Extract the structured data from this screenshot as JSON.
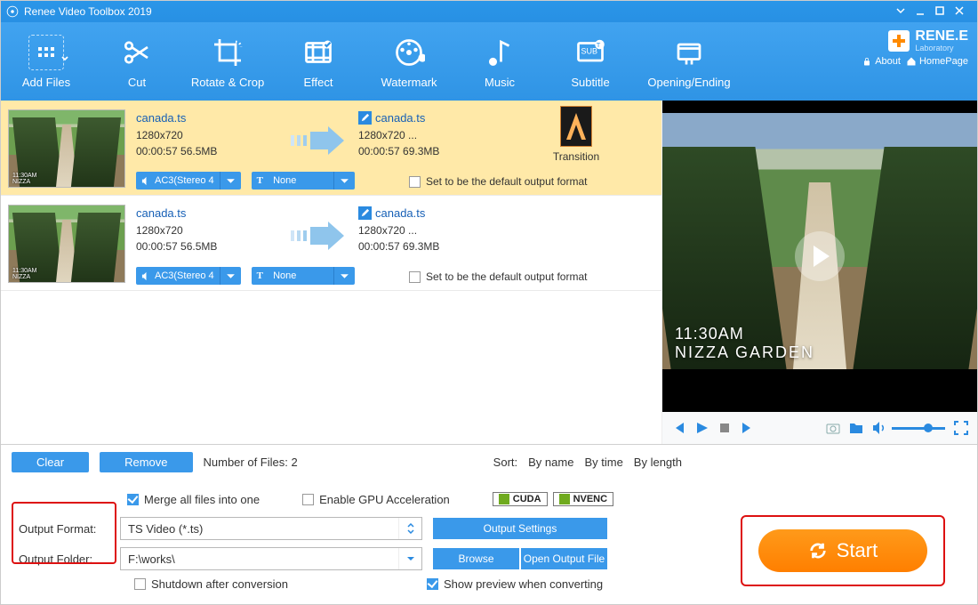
{
  "title": "Renee Video Toolbox 2019",
  "brand": {
    "name": "RENE.E",
    "sub": "Laboratory",
    "about": "About",
    "homepage": "HomePage"
  },
  "toolbar": {
    "addfiles": "Add Files",
    "cut": "Cut",
    "rotate": "Rotate & Crop",
    "effect": "Effect",
    "watermark": "Watermark",
    "music": "Music",
    "subtitle": "Subtitle",
    "opening": "Opening/Ending"
  },
  "rows": [
    {
      "in": {
        "name": "canada.ts",
        "res": "1280x720",
        "dur": "00:00:57  56.5MB"
      },
      "out": {
        "name": "canada.ts",
        "res": "1280x720    ...",
        "dur": "00:00:57  69.3MB"
      },
      "audio": "AC3(Stereo 4",
      "text": "None",
      "deflabel": "Set to be the default output format",
      "trn": "Transition"
    },
    {
      "in": {
        "name": "canada.ts",
        "res": "1280x720",
        "dur": "00:00:57  56.5MB"
      },
      "out": {
        "name": "canada.ts",
        "res": "1280x720    ...",
        "dur": "00:00:57  69.3MB"
      },
      "audio": "AC3(Stereo 4",
      "text": "None",
      "defaultlabel": "Set to be the default output format"
    }
  ],
  "preview": {
    "time": "11:30AM",
    "place": "NIZZA GARDEN"
  },
  "bottom": {
    "clear": "Clear",
    "remove": "Remove",
    "count": "Number of Files:  2",
    "sort": "Sort:",
    "byname": "By name",
    "bytime": "By time",
    "bylength": "By length",
    "merge": "Merge all files into one",
    "gpu": "Enable GPU Acceleration",
    "cuda": "CUDA",
    "nvenc": "NVENC",
    "outfmt": "Output Format:",
    "outfmtval": "TS Video (*.ts)",
    "outfolder": "Output Folder:",
    "outfolderval": "F:\\works\\",
    "outsettings": "Output Settings",
    "browse": "Browse",
    "openfolder": "Open Output File",
    "shutdown": "Shutdown after conversion",
    "showprev": "Show preview when converting",
    "start": "Start"
  }
}
